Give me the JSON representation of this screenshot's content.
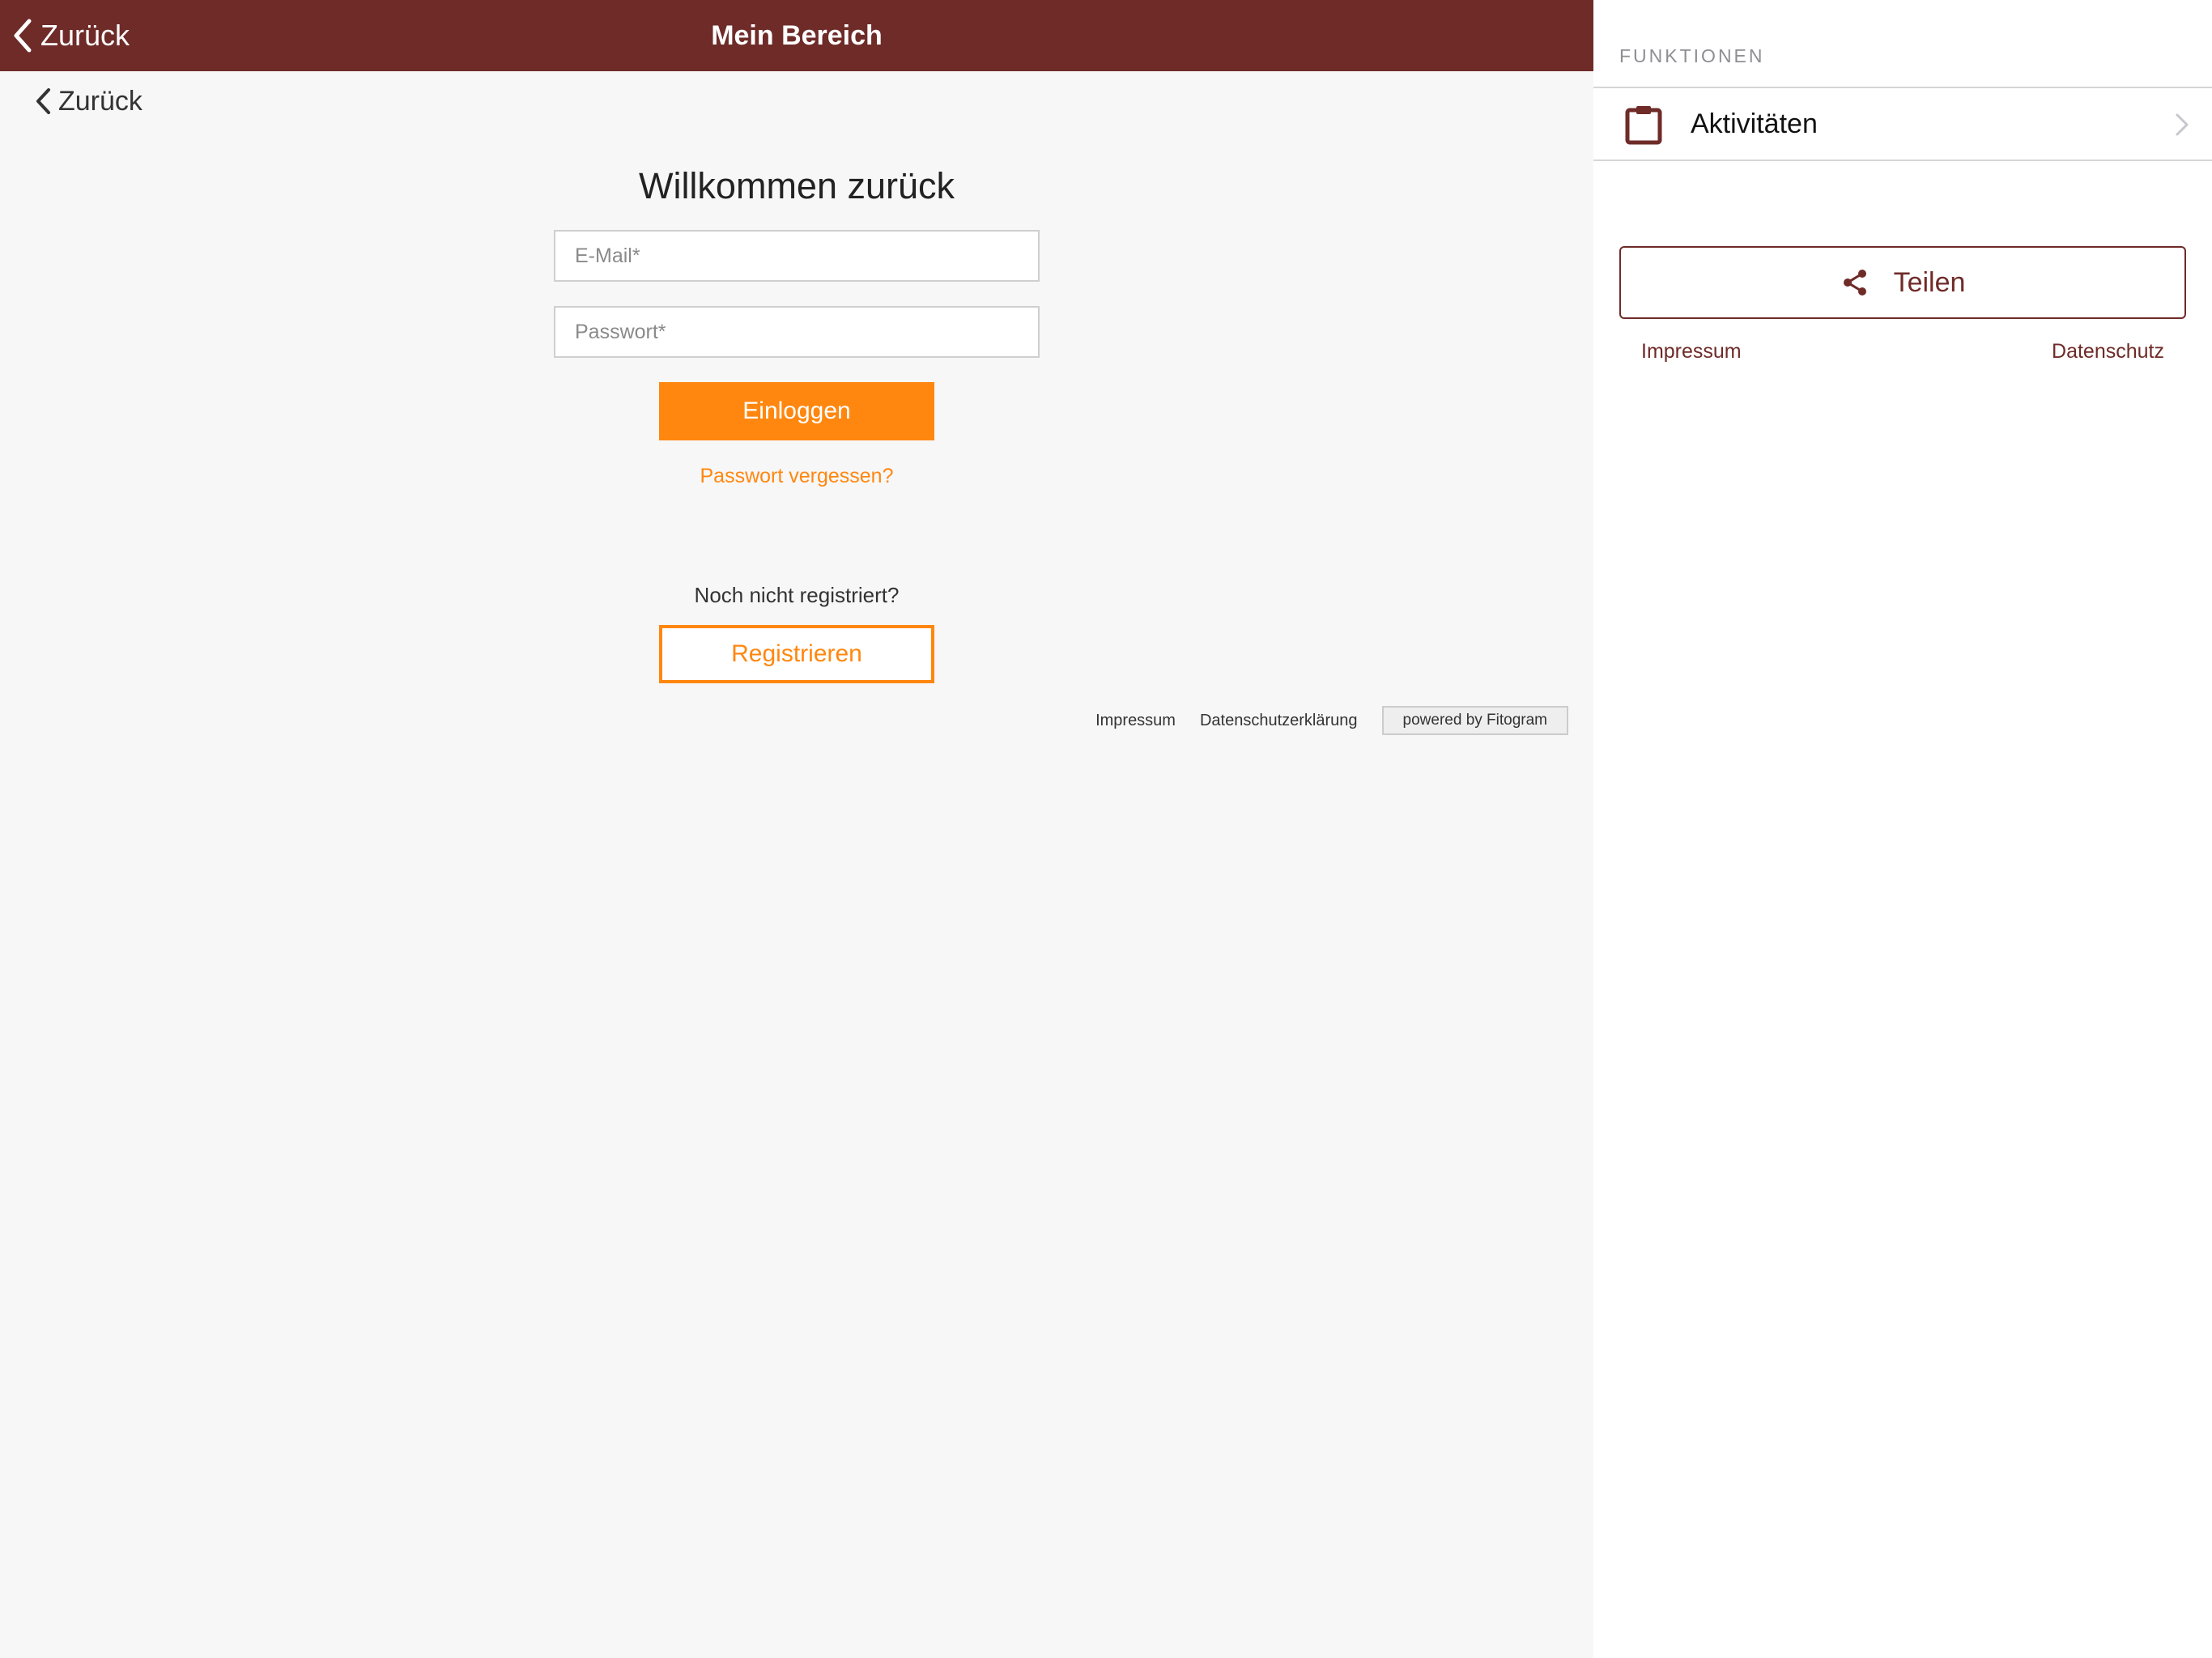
{
  "colors": {
    "nav_bar": "#6e2b28",
    "accent_orange": "#ff870f",
    "brand_dark_red": "#6e2b28",
    "left_background": "#f7f7f7",
    "right_background": "#ffffff"
  },
  "nav_bar": {
    "back_label": "Zurück",
    "back_icon": "chevron-left-icon",
    "title": "Mein Bereich"
  },
  "web_view": {
    "back_label": "Zurück",
    "welcome_title": "Willkommen zurück",
    "email_placeholder": "E-Mail*",
    "email_value": "",
    "password_placeholder": "Passwort*",
    "password_value": "",
    "login_label": "Einloggen",
    "forgot_password_label": "Passwort vergessen?",
    "not_registered_text": "Noch nicht registriert?",
    "register_label": "Registrieren",
    "footer": {
      "impressum_label": "Impressum",
      "privacy_label": "Datenschutzerklärung",
      "powered_by_label": "powered by  Fitogram"
    }
  },
  "side_panel": {
    "section_title": "FUNKTIONEN",
    "items": [
      {
        "label": "Aktivitäten",
        "icon": "clipboard-icon"
      }
    ],
    "share_label": "Teilen",
    "share_icon": "share-icon",
    "impressum_label": "Impressum",
    "privacy_label": "Datenschutz"
  }
}
